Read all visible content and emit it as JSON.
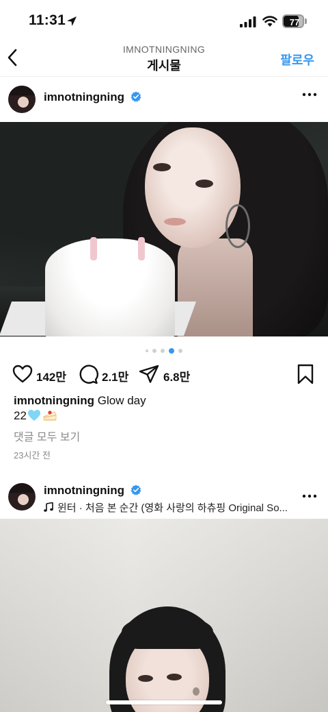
{
  "status_bar": {
    "time": "11:31",
    "battery": "77",
    "battery_level": 0.77
  },
  "nav": {
    "subtitle": "IMNOTNINGNING",
    "title": "게시물",
    "follow_label": "팔로우"
  },
  "posts": [
    {
      "username": "imnotningning",
      "carousel": {
        "dots": 5,
        "active_index": 3
      },
      "likes": "142만",
      "comments": "2.1만",
      "shares": "6.8만",
      "caption_user": "imnotningning",
      "caption_text": "Glow day",
      "caption_line2": "22",
      "view_comments": "댓글 모두 보기",
      "timestamp": "23시간 전"
    },
    {
      "username": "imnotningning",
      "music": "윈터 · 처음 본 순간 (영화 사랑의 하츄핑 Original So..."
    }
  ],
  "colors": {
    "accent": "#3797f0",
    "verified": "#3797f0",
    "secondary_text": "#8a8a8a"
  },
  "icons": [
    "location-arrow-icon",
    "signal-icon",
    "wifi-icon",
    "battery-icon",
    "back-chevron-icon",
    "verified-badge-icon",
    "more-dots-icon",
    "heart-icon",
    "comment-icon",
    "share-icon",
    "bookmark-icon",
    "music-note-icon",
    "light-blue-heart-emoji",
    "shortcake-emoji"
  ]
}
